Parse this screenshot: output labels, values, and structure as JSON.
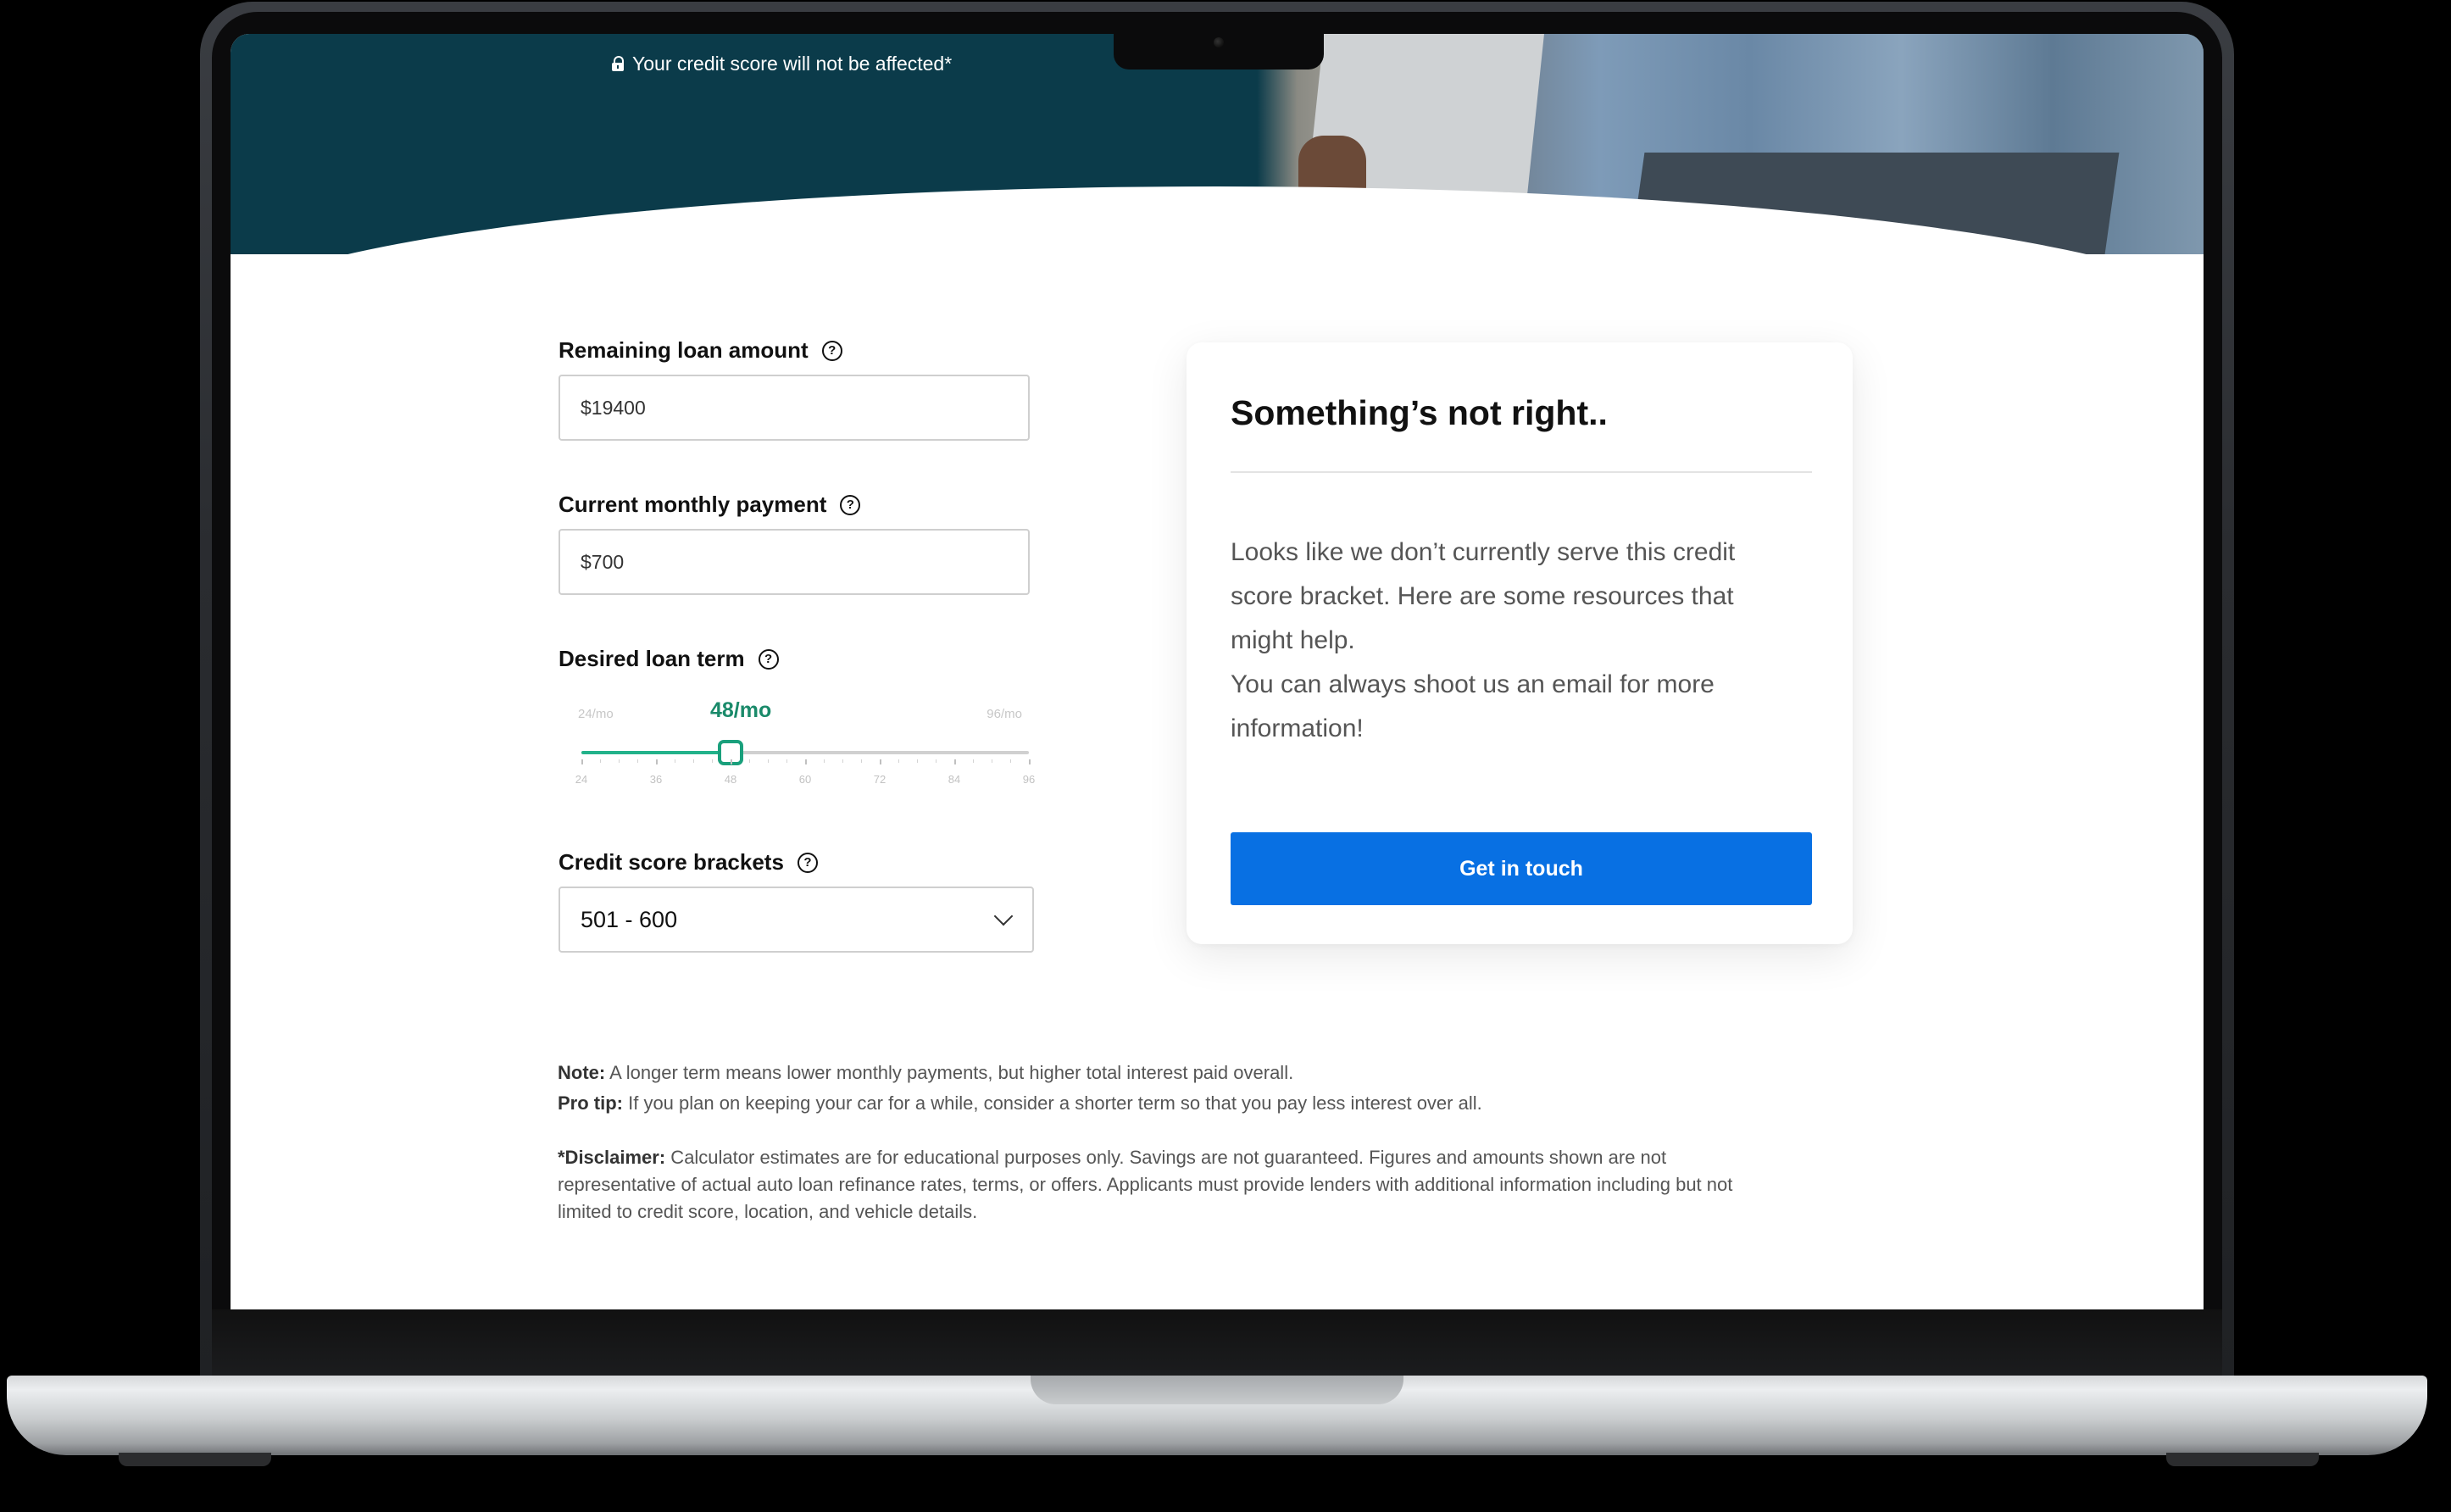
{
  "hero": {
    "note": "Your credit score will not be affected*"
  },
  "form": {
    "remaining_loan_amount": {
      "label": "Remaining loan amount",
      "value": "$19400"
    },
    "current_monthly_payment": {
      "label": "Current monthly payment",
      "value": "$700"
    },
    "desired_loan_term": {
      "label": "Desired loan term",
      "min_label": "24/mo",
      "max_label": "96/mo",
      "current_label": "48/mo",
      "value": 48,
      "min": 24,
      "max": 96,
      "tick_labels": [
        "24",
        "36",
        "48",
        "60",
        "72",
        "84",
        "96"
      ]
    },
    "credit_score_brackets": {
      "label": "Credit score brackets",
      "selected": "501 - 600"
    },
    "help_glyph": "?"
  },
  "card": {
    "title": "Something’s not right..",
    "body_1": "Looks like we don’t currently serve this credit score bracket. Here are some resources that might help.",
    "body_2": "You can always shoot us an email for more information!",
    "button": "Get in touch"
  },
  "notes": {
    "note_label": "Note:",
    "note_text": " A longer term means lower monthly payments, but higher total interest paid overall.",
    "tip_label": "Pro tip:",
    "tip_text": " If you plan on keeping your car for a while, consider a shorter term so that you pay less interest over all.",
    "disclaimer_label": "*Disclaimer:",
    "disclaimer_text": " Calculator estimates are for educational purposes only. Savings are not guaranteed. Figures and amounts shown are not representative of actual auto loan refinance rates, terms, or offers. Applicants must provide lenders with additional information including but not limited to credit score, location, and vehicle details."
  },
  "colors": {
    "hero_bg": "#0b3b4a",
    "accent_green": "#1aa07c",
    "button_blue": "#0870e3"
  }
}
